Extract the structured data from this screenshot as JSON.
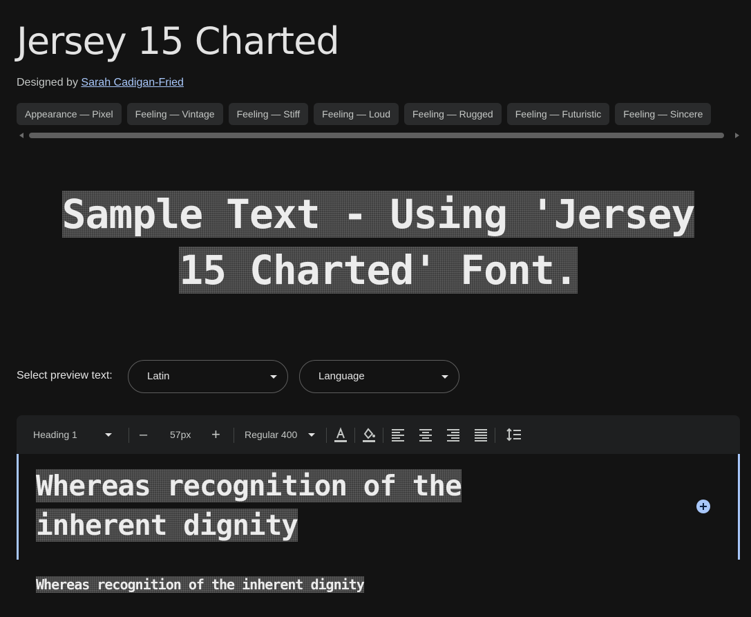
{
  "font": {
    "title": "Jersey 15 Charted",
    "designed_by_label": "Designed by",
    "designer": "Sarah Cadigan-Fried"
  },
  "tags": [
    "Appearance — Pixel",
    "Feeling — Vintage",
    "Feeling — Stiff",
    "Feeling — Loud",
    "Feeling — Rugged",
    "Feeling — Futuristic",
    "Feeling — Sincere"
  ],
  "hero_sample": "Sample Text - Using 'Jersey 15 Charted' Font.",
  "preview": {
    "label": "Select preview text:",
    "script_value": "Latin",
    "language_value": "Language"
  },
  "toolbar": {
    "style": "Heading 1",
    "size": "57px",
    "weight": "Regular 400",
    "decrease_glyph": "–",
    "increase_glyph": "+"
  },
  "editor": {
    "text": "Whereas recognition of the inherent dignity"
  },
  "small_sample": "Whereas recognition of the inherent dignity",
  "colors": {
    "background": "#131313",
    "accent": "#a8c7fa",
    "chip": "#2a2b2c",
    "toolbar": "#1e1f20"
  },
  "icons": [
    "scroll-left-icon",
    "scroll-right-icon",
    "chevron-down-icon",
    "text-color-icon",
    "highlight-color-icon",
    "align-left-icon",
    "align-center-icon",
    "align-right-icon",
    "align-justify-icon",
    "line-height-icon",
    "add-circle-icon"
  ]
}
